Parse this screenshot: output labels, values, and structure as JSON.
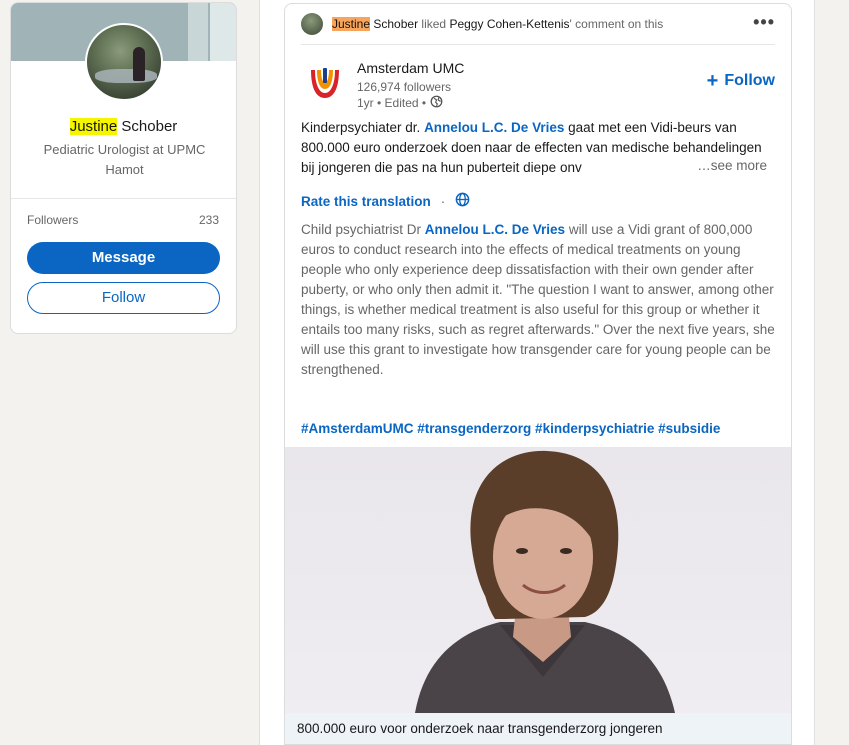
{
  "profile": {
    "first_name_highlight": "Justine",
    "last_name": "Schober",
    "headline": "Pediatric Urologist at UPMC Hamot",
    "followers_label": "Followers",
    "followers_count": "233",
    "message_label": "Message",
    "follow_label": "Follow"
  },
  "post": {
    "activity": {
      "actor_highlight": "Justine",
      "actor_rest": "Schober",
      "verb": "liked",
      "target": "Peggy Cohen-Kettenis",
      "suffix": "' comment on this",
      "more_icon": "more-horizontal-icon"
    },
    "org": {
      "name": "Amsterdam UMC",
      "followers": "126,974 followers",
      "meta": "1yr • Edited •",
      "visibility_icon": "globe-icon",
      "follow_label": "Follow",
      "logo_colors": {
        "red": "#d8232a",
        "orange": "#f39200",
        "blue": "#1d3e8f"
      }
    },
    "text_before_link": "Kinderpsychiater dr. ",
    "text_link": "Annelou L.C. De Vries",
    "text_after_link": " gaat met een Vidi-beurs van 800.000 euro onderzoek doen naar de effecten van medische behandelingen bij jongeren die pas na hun puberteit diepe onv",
    "see_more": "…see more",
    "translation": {
      "rate_label": "Rate this translation",
      "separator": "·",
      "icon": "globe-icon",
      "text_before_link": "Child psychiatrist Dr ",
      "text_link": "Annelou L.C. De Vries",
      "text_after_link": " will use a Vidi grant of 800,000 euros to conduct research into the effects of medical treatments on young people who only experience deep dissatisfaction with their own gender after puberty, or who only then admit it. \"The question I want to answer, among other things, is whether medical treatment is also useful for this group or whether it entails too many risks, such as regret afterwards.\" Over the next five years, she will use this grant to investigate how transgender care for young people can be strengthened."
    },
    "hashtags": "#AmsterdamUMC #transgenderzorg #kinderpsychiatrie #subsidie",
    "image_caption": "800.000 euro voor onderzoek naar transgenderzorg jongeren"
  }
}
